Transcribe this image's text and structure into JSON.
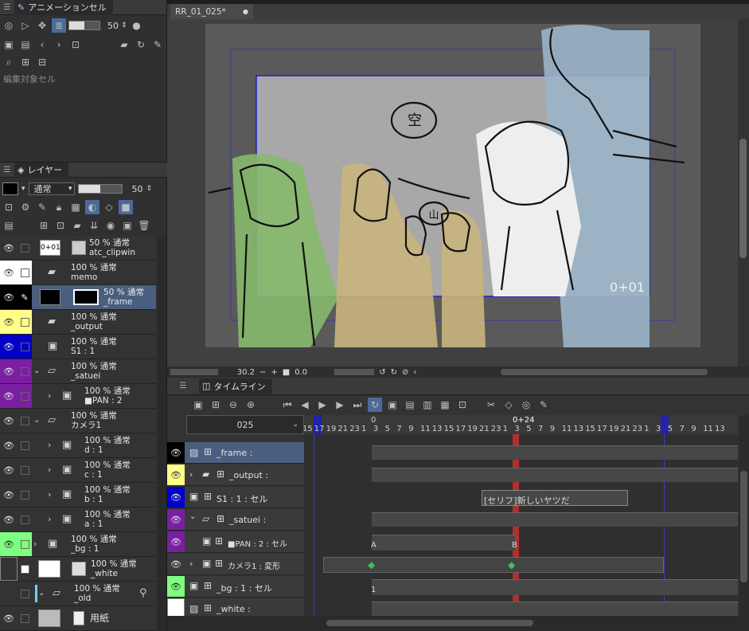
{
  "anim_panel": {
    "tab_label": "アニメーションセル",
    "opacity_value": "50",
    "target_label": "編集対象セル"
  },
  "layer_panel": {
    "tab_label": "レイヤー",
    "blend_mode": "通常",
    "opacity_value": "50",
    "layers": [
      {
        "mode": "50 % 通常",
        "name": "atc_clipwin",
        "thumb_text": "0+01",
        "eye_color": "#333333",
        "sq_color": "#333333"
      },
      {
        "mode": "100 % 通常",
        "name": "memo",
        "eye_color": "#ffffff",
        "sq_color": "#ffffff"
      },
      {
        "mode": "50 % 通常",
        "name": "_frame",
        "eye_color": "#000000",
        "sq_color": "#000000"
      },
      {
        "mode": "100 % 通常",
        "name": "_output",
        "eye_color": "#ffff88",
        "sq_color": "#ffff88"
      },
      {
        "mode": "100 % 通常",
        "name": "S1 : 1",
        "eye_color": "#0000c8",
        "sq_color": "#0000c8"
      },
      {
        "mode": "100 % 通常",
        "name": "_satuei",
        "eye_color": "#7a1fa2",
        "sq_color": "#7a1fa2"
      },
      {
        "mode": "100 % 通常",
        "name": "■PAN : 2",
        "eye_color": "#7a1fa2",
        "sq_color": "#7a1fa2"
      },
      {
        "mode": "100 % 通常",
        "name": "カメラ1",
        "eye_color": "#333333",
        "sq_color": "#333333"
      },
      {
        "mode": "100 % 通常",
        "name": "d : 1",
        "eye_color": "#333333",
        "sq_color": "#333333"
      },
      {
        "mode": "100 % 通常",
        "name": "c : 1",
        "eye_color": "#333333",
        "sq_color": "#333333"
      },
      {
        "mode": "100 % 通常",
        "name": "b : 1",
        "eye_color": "#333333",
        "sq_color": "#333333"
      },
      {
        "mode": "100 % 通常",
        "name": "a  : 1",
        "eye_color": "#333333",
        "sq_color": "#333333"
      },
      {
        "mode": "100 % 通常",
        "name": "_bg : 1",
        "eye_color": "#7fff7f",
        "sq_color": "#7fff7f"
      },
      {
        "mode": "100 % 通常",
        "name": "_white",
        "eye_color": "#ffffff",
        "sq_color": "#ffffff"
      },
      {
        "mode": "100 % 通常",
        "name": "_old",
        "eye_color": "#333333",
        "sq_color": "#333333"
      },
      {
        "mode": "",
        "name": "用紙",
        "eye_color": "#333333",
        "sq_color": "#333333"
      }
    ]
  },
  "canvas": {
    "tab_title": "RR_01_025*",
    "frame_counter": "0+01",
    "sign_sora": "空",
    "sign_yama": "山",
    "zoom_value": "30.2",
    "rotate_value": "0.0"
  },
  "timeline": {
    "tab_label": "タイムライン",
    "cut_select": "025",
    "header_marker": "0",
    "playhead_label": "0+24",
    "ruler": [
      "15",
      "17",
      "19",
      "21",
      "23",
      "1",
      "3",
      "5",
      "7",
      "9",
      "11",
      "13",
      "15",
      "17",
      "19",
      "21",
      "23",
      "1",
      "3",
      "5",
      "7",
      "9",
      "11",
      "13",
      "15",
      "17",
      "19",
      "21",
      "23",
      "1",
      "3",
      "5",
      "7",
      "9",
      "11",
      "13"
    ],
    "tracks": [
      {
        "name": "_frame :",
        "color": "#000000"
      },
      {
        "name": "_output :",
        "color": "#ffff88"
      },
      {
        "name": "S1 : 1 : セル",
        "color": "#0000c8"
      },
      {
        "name": "_satuei :",
        "color": "#7a1fa2"
      },
      {
        "name": "■PAN : 2 : セル",
        "color": "#7a1fa2"
      },
      {
        "name": "カメラ1 : 変形",
        "color": "#333333"
      },
      {
        "name": "_bg : 1 : セル",
        "color": "#7fff7f"
      },
      {
        "name": "_white :",
        "color": "#ffffff"
      }
    ],
    "dialogue": "[セリフ]新しいヤツだ",
    "key_a": "A",
    "key_b": "B",
    "bg_mark": "1"
  }
}
